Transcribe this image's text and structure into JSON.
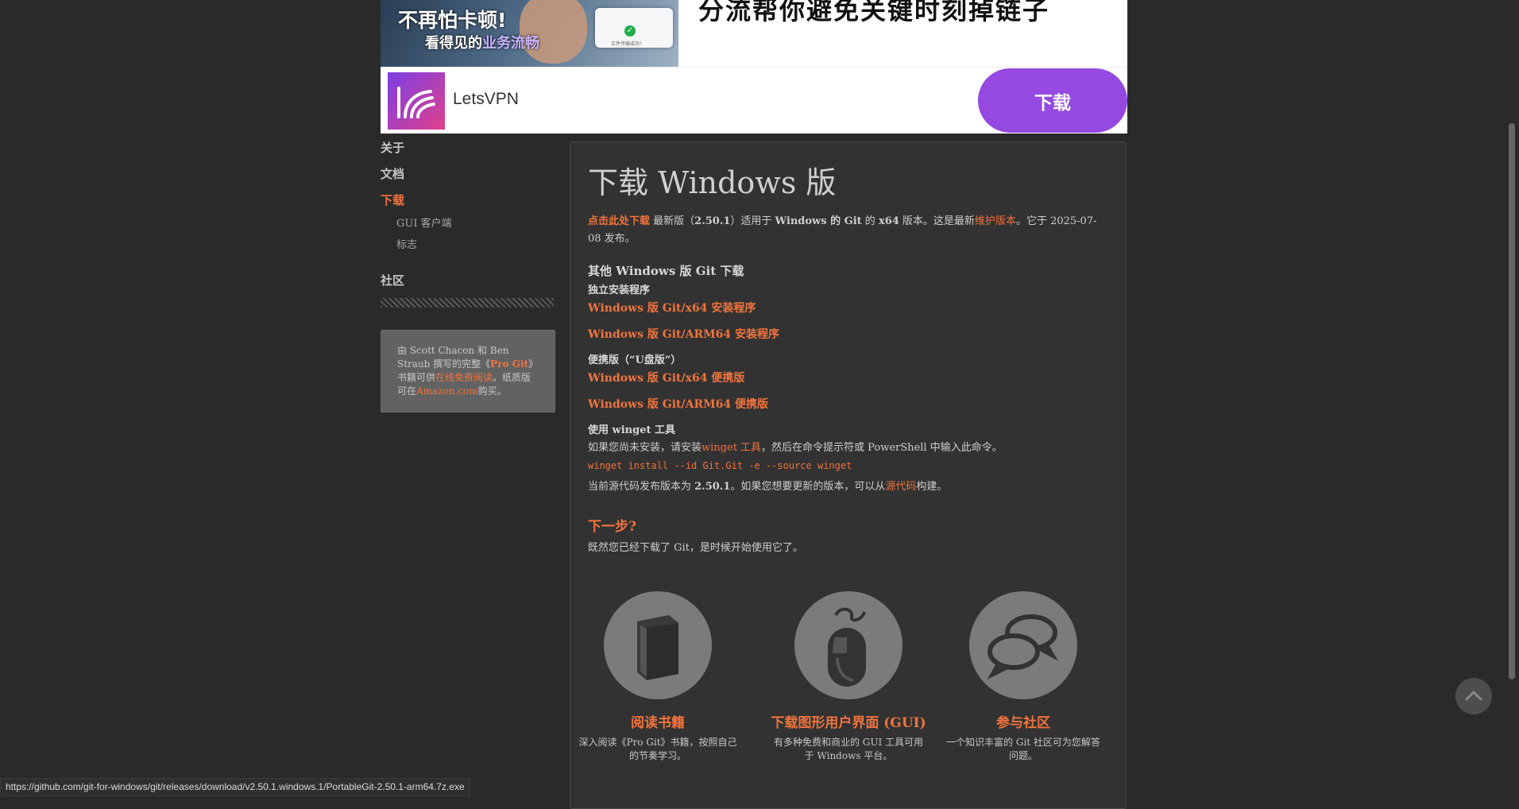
{
  "ad": {
    "image_line1": "不再怕卡顿!",
    "image_line2_prefix": "看得见的",
    "image_line2_highlight": "业务流畅",
    "popup_text": "文件传输成功！",
    "headline": "分流帮你避免关键时刻掉链子",
    "brand": "LetsVPN",
    "button": "下载"
  },
  "sidebar": {
    "about": "关于",
    "docs": "文档",
    "downloads": "下载",
    "gui_clients": "GUI 客户端",
    "logos": "标志",
    "community": "社区",
    "book": {
      "t1": "由 Scott Chacon 和 Ben Straub 撰写的完整《",
      "progit": "Pro Git",
      "t2": "》书籍可供",
      "read_online": "在线免费阅读",
      "t3": "。纸质版可在",
      "amazon": "Amazon.com",
      "t4": "购买。"
    }
  },
  "main": {
    "title": "下载 Windows 版",
    "intro": {
      "click_here": "点击此处下载",
      "t1": " 最新版（",
      "version": "2.50.1",
      "t2": "）适用于 ",
      "win_git": "Windows 的 Git",
      "t3": " 的 ",
      "arch": "x64",
      "t4": " 版本。这是最新",
      "maint": "维护版本",
      "t5": "。它于 2025-07-08 发布。"
    },
    "other_title": "其他 Windows 版 Git 下载",
    "standalone_title": "独立安装程序",
    "dl_x64_installer": "Windows 版 Git/x64 安装程序",
    "dl_arm64_installer": "Windows 版 Git/ARM64 安装程序",
    "portable_title": "便携版（“U盘版”）",
    "dl_x64_portable": "Windows 版 Git/x64 便携版",
    "dl_arm64_portable": "Windows 版 Git/ARM64 便携版",
    "winget_title": "使用 winget 工具",
    "winget": {
      "t1": "如果您尚未安装，请安装",
      "link": "winget 工具",
      "t2": "，然后在命令提示符或 PowerShell 中输入此命令。"
    },
    "winget_cmd": "winget install --id Git.Git -e --source winget",
    "source": {
      "t1": "当前源代码发布版本为 ",
      "version": "2.50.1",
      "t2": "。如果您想要更新的版本，可以从",
      "link": "源代码",
      "t3": "构建。"
    },
    "next_title": "下一步?",
    "next_text": "既然您已经下载了 Git，是时候开始使用它了。",
    "cards": [
      {
        "title": "阅读书籍",
        "desc": "深入阅读《Pro Git》书籍，按照自己的节奏学习。",
        "icon": "book-icon"
      },
      {
        "title": "下载图形用户界面 (GUI)",
        "desc": "有多种免费和商业的 GUI 工具可用于 Windows 平台。",
        "icon": "mouse-icon"
      },
      {
        "title": "参与社区",
        "desc": "一个知识丰富的 Git 社区可为您解答问题。",
        "icon": "chat-bubbles-icon"
      }
    ]
  },
  "status_url": "https://github.com/git-for-windows/git/releases/download/v2.50.1.windows.1/PortableGit-2.50.1-arm64.7z.exe",
  "colors": {
    "accent": "#f0743e",
    "background": "#2a2a2a",
    "ad_button": "#9549e0"
  }
}
